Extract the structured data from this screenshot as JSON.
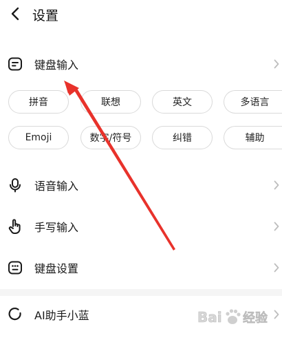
{
  "header": {
    "title": "设置",
    "back_icon": "chevron-left-icon"
  },
  "sections": {
    "keyboard_input": {
      "label": "键盘输入",
      "icon": "keyboard-input-icon"
    },
    "voice_input": {
      "label": "语音输入",
      "icon": "microphone-icon"
    },
    "handwriting_input": {
      "label": "手写输入",
      "icon": "hand-pointer-icon"
    },
    "keyboard_settings": {
      "label": "键盘设置",
      "icon": "keyboard-icon"
    },
    "ai_assistant": {
      "label": "AI助手小蓝",
      "icon": "ai-ring-icon"
    }
  },
  "chips": {
    "row1": [
      "拼音",
      "联想",
      "英文",
      "多语言"
    ],
    "row2": [
      "Emoji",
      "数字/符号",
      "纠错",
      "辅助"
    ]
  },
  "watermark": {
    "text": "Baidu 经验"
  },
  "colors": {
    "annotation_arrow": "#e8322b",
    "chip_border": "#d9d9d9",
    "chevron": "#bdbdbd",
    "icon": "#1a1a1a"
  }
}
